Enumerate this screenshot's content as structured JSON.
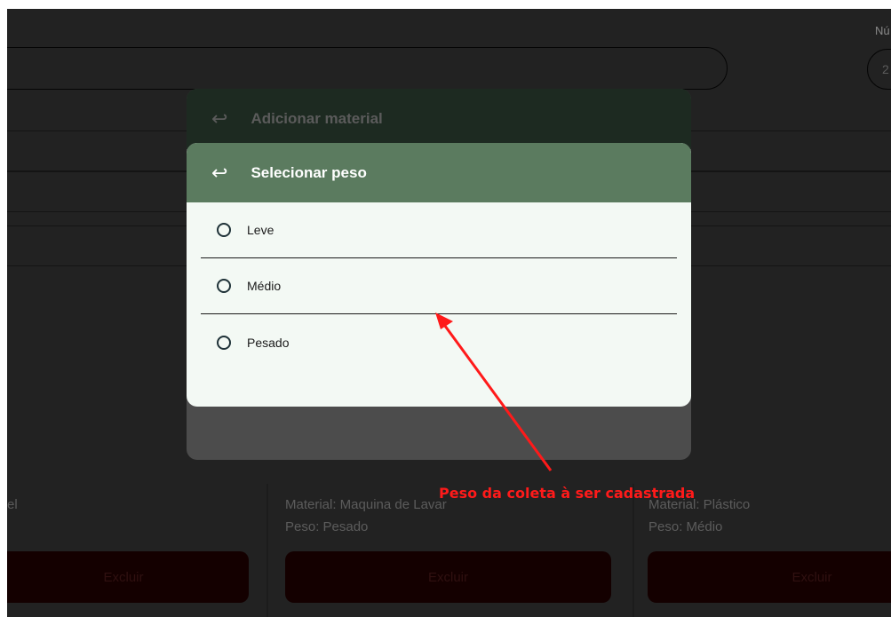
{
  "background": {
    "top_label": "Nú",
    "top_input_value": "2",
    "cards": [
      {
        "material_line": "el",
        "excluir_label": "Excluir"
      },
      {
        "material_line": "Material: Maquina de Lavar",
        "peso_line": "Peso: Pesado",
        "excluir_label": "Excluir"
      },
      {
        "material_line": "Material: Plástico",
        "peso_line": "Peso: Médio",
        "excluir_label": "Excluir"
      }
    ]
  },
  "back_dialog": {
    "title": "Adicionar material",
    "back_icon": "return-arrow-icon"
  },
  "front_dialog": {
    "title": "Selecionar peso",
    "back_icon": "return-arrow-icon",
    "options": [
      {
        "label": "Leve",
        "selected": false
      },
      {
        "label": "Médio",
        "selected": false
      },
      {
        "label": "Pesado",
        "selected": false
      }
    ]
  },
  "annotation": {
    "text": "Peso da coleta à ser cadastrada",
    "color": "#ff1a1a"
  },
  "colors": {
    "overlay_header": "#5b7b5f",
    "dialog_bg": "#f3f9f4",
    "page_bg": "#222222"
  }
}
